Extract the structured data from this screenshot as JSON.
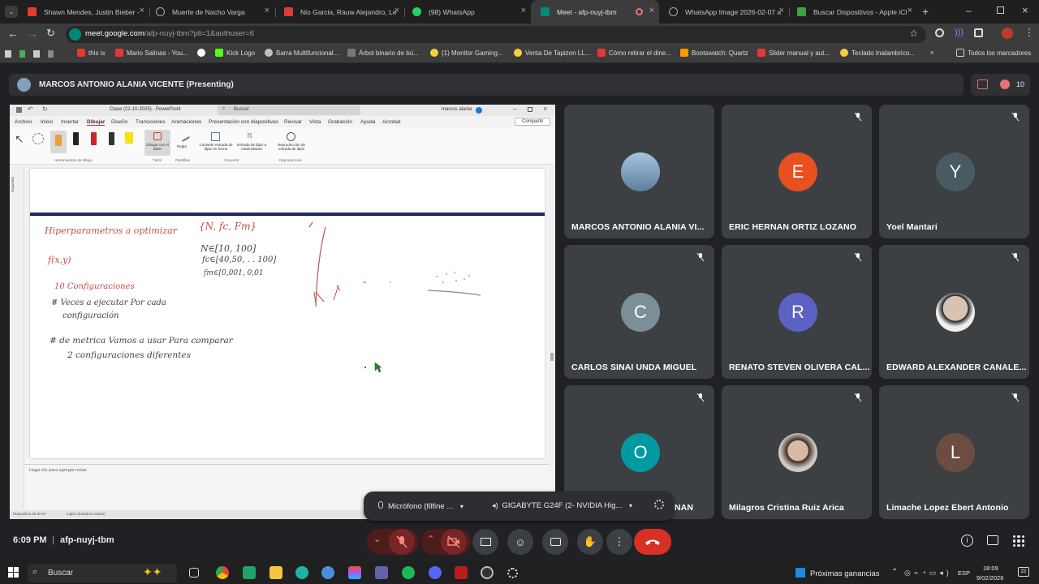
{
  "browser": {
    "tabs": [
      {
        "title": "Shawn Mendes, Justin Bieber -",
        "fav_color": "#e53935"
      },
      {
        "title": "Muerte de Nacho Varga",
        "fav_color": "#9e9e9e"
      },
      {
        "title": "Nio Garcia, Rauw Alejandro, Le",
        "fav_color": "#e53935"
      },
      {
        "title": "(98) WhatsApp",
        "fav_color": "#25d366"
      },
      {
        "title": "Meet - afp-nuyj-tbm",
        "fav_color": "#00897b"
      },
      {
        "title": "WhatsApp Image 2026-02-07 a",
        "fav_color": "#9e9e9e"
      },
      {
        "title": "Buscar Dispositivos - Apple iCl",
        "fav_color": "#43a047"
      }
    ],
    "url_host": "meet.google.com",
    "url_path": "/afp-nuyj-tbm?pli=1&authuser=6",
    "bookmarks": [
      {
        "label": "this is",
        "color": "#e53935"
      },
      {
        "label": "Mario Salinas - You...",
        "color": "#e53935"
      },
      {
        "label": "Kick Logo",
        "color": "#53fc18"
      },
      {
        "label": "Barra Multifuncional...",
        "color": "#c0c0c0"
      },
      {
        "label": "Árbol binario de bú...",
        "color": "#9e9e9e"
      },
      {
        "label": "(1) Monitor Gaming...",
        "color": "#f4d03f"
      },
      {
        "label": "Venta De Tapizon LL...",
        "color": "#f4d03f"
      },
      {
        "label": "Cómo retirar el dine...",
        "color": "#e53935"
      },
      {
        "label": "Bootswatch: Quartz",
        "color": "#ff9800"
      },
      {
        "label": "Slider manual y aut...",
        "color": "#e53935"
      },
      {
        "label": "Teclado Inalambrico...",
        "color": "#f4d03f"
      }
    ],
    "bookmarks_more": "»",
    "all_bookmarks": "Todos los marcadores"
  },
  "meet": {
    "presenter_title": "MARCOS ANTONIO ALANIA VICENTE (Presenting)",
    "participant_count": "10",
    "time": "6:09 PM",
    "meeting_code": "afp-nuyj-tbm",
    "participants": [
      {
        "name": "MARCOS ANTONIO ALANIA VI...",
        "initial": "",
        "color": "#6a8caf",
        "photo": true,
        "muted": false
      },
      {
        "name": "ERIC HERNAN ORTIZ LOZANO",
        "initial": "E",
        "color": "#e8501f",
        "photo": false,
        "muted": true
      },
      {
        "name": "Yoel Mantari",
        "initial": "Y",
        "color": "#4a5a63",
        "photo": false,
        "muted": true
      },
      {
        "name": "CARLOS SINAI UNDA MIGUEL",
        "initial": "C",
        "color": "#7b8f99",
        "photo": false,
        "muted": true
      },
      {
        "name": "RENATO STEVEN OLIVERA CAL...",
        "initial": "R",
        "color": "#5b62c4",
        "photo": false,
        "muted": true
      },
      {
        "name": "EDWARD ALEXANDER CANALE...",
        "initial": "",
        "color": "#c9b9ad",
        "photo": true,
        "muted": true
      },
      {
        "name": "NAN",
        "initial": "O",
        "color": "#009aa0",
        "photo": false,
        "muted": true
      },
      {
        "name": "Milagros Cristina Ruiz Arica",
        "initial": "",
        "color": "#b89987",
        "photo": true,
        "muted": true
      },
      {
        "name": "Limache Lopez Ebert Antonio",
        "initial": "L",
        "color": "#6d4c41",
        "photo": false,
        "muted": true
      }
    ],
    "device_bar": {
      "mic": "Micrófono (filfine ...",
      "speaker": "GIGABYTE G24F (2- NVIDIA Hig..."
    }
  },
  "ppt": {
    "title": "Clase (22-10-2025) - PowerPoint",
    "search": "Buscar",
    "user": "marcos alania",
    "ribbon_tabs": [
      "Archivo",
      "Inicio",
      "Insertar",
      "Dibujar",
      "Diseño",
      "Transiciones",
      "Animaciones",
      "Presentación con diapositivas",
      "Revisar",
      "Vista",
      "Grabación",
      "Ayuda",
      "Acrobat"
    ],
    "share": "Compartir",
    "groups": [
      "Herramientas de dibujo",
      "Táctil",
      "Plantillas",
      "Convertir",
      "Reproducción"
    ],
    "cmds": [
      "Dibujar con el dedo",
      "Regla",
      "Convertir entrada de lápiz en forma",
      "Entrada de lápiz a matemáticas",
      "Reproducción de entrada de lápiz"
    ],
    "side_label": "Esquema",
    "notes": "Haga clic para agregar notas",
    "status_slide": "Diapositiva 46 de 57",
    "status_lang": "Inglés (Estados Unidos)",
    "ink": {
      "hyper": "Hiperparametros a optimizar",
      "set": "{N, fc, Fm}",
      "f_label": "f(x,y)",
      "n_range": "N∈[10, 100]",
      "fc_range": "fc∈[40,50, . . 100]",
      "fm_range": "fm∈[0,001, 0,01",
      "configs": "10 Configuraciones",
      "veces1": "# Veces a ejecutar Por cada",
      "veces2": "configuración",
      "metrica1": "# de metrica Vamos a usar Para comparar",
      "metrica2": "2 configuraciones diferentes"
    }
  },
  "taskbar": {
    "search": "Buscar",
    "news": "Próximas ganancias",
    "lang": "ESP",
    "time": "18:09",
    "date": "9/02/2026",
    "notif": "22"
  }
}
